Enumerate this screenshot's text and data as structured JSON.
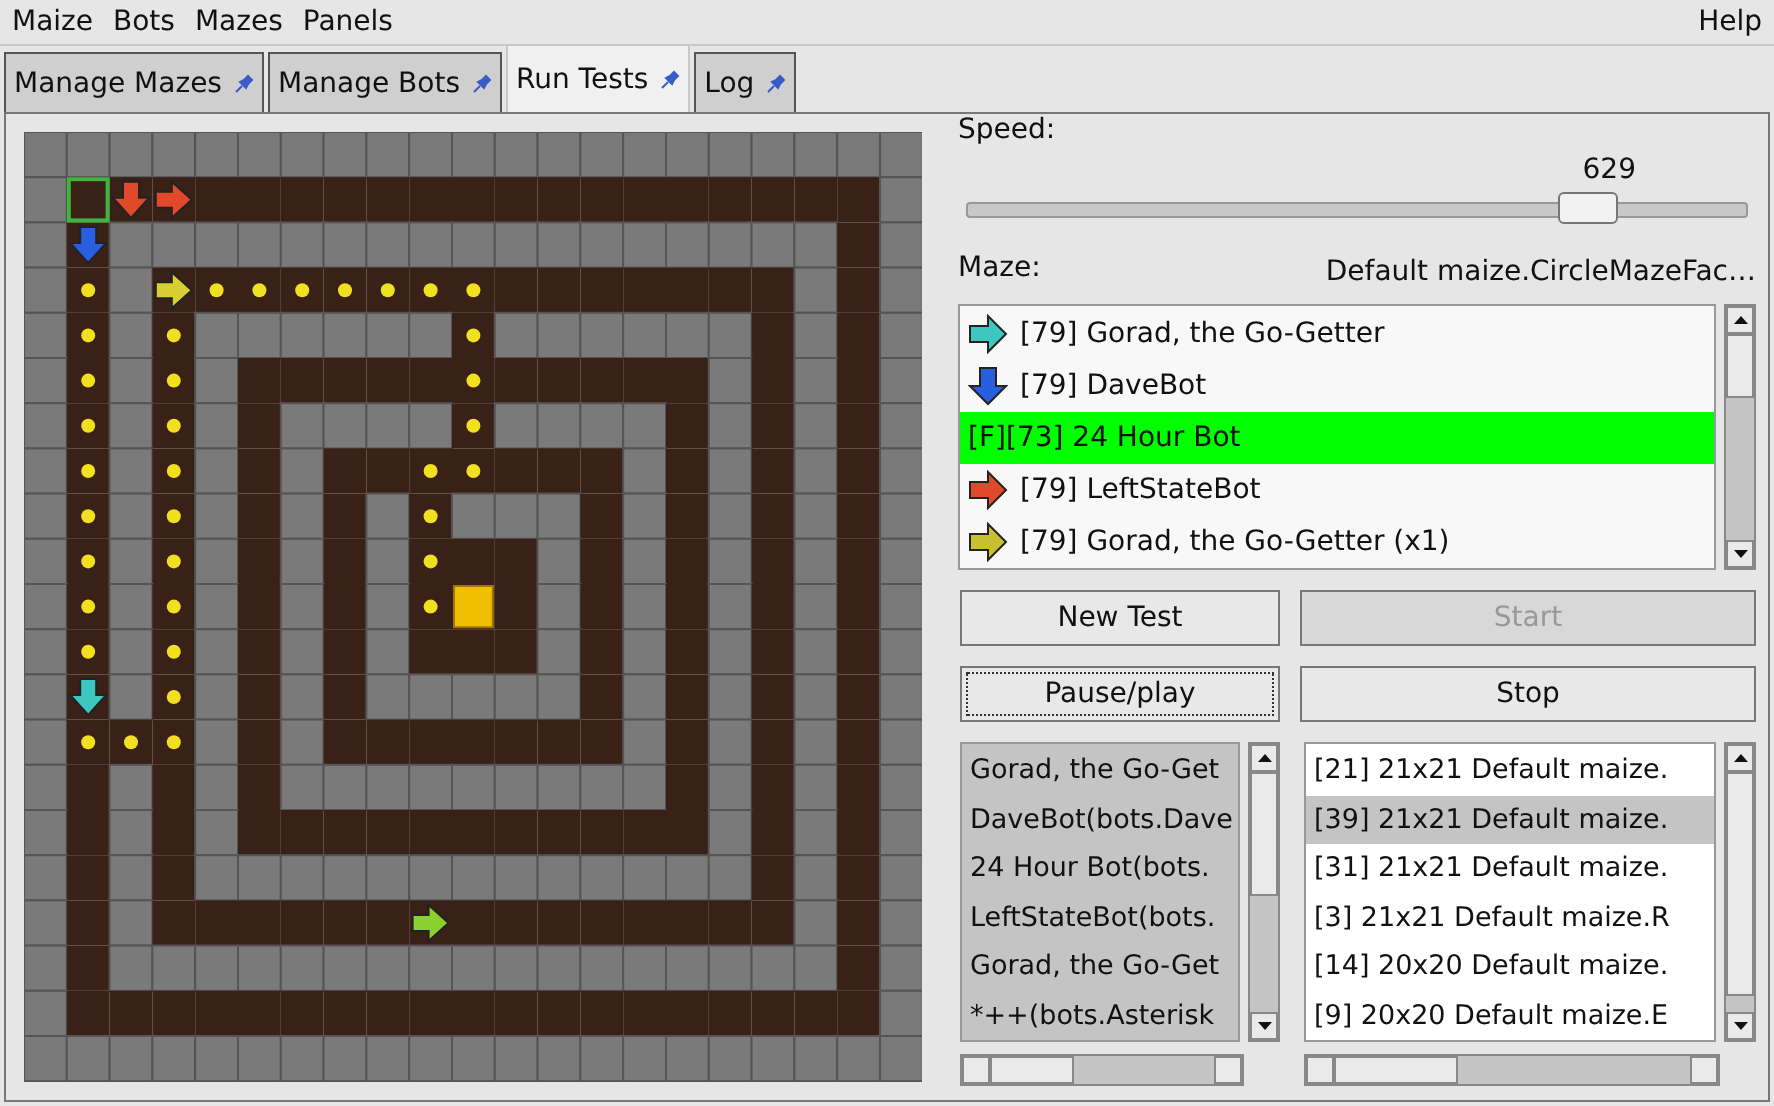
{
  "menu": [
    "Maize",
    "Bots",
    "Mazes",
    "Panels"
  ],
  "menu_help": "Help",
  "tabs": [
    {
      "label": "Manage Mazes",
      "selected": false
    },
    {
      "label": "Manage Bots",
      "selected": false
    },
    {
      "label": "Run Tests",
      "selected": true
    },
    {
      "label": "Log",
      "selected": false
    }
  ],
  "speed": {
    "label": "Speed:",
    "value": "629",
    "level": 0.815
  },
  "maze": {
    "label": "Maze:",
    "value": "Default maize.CircleMazeFac…"
  },
  "bots": [
    {
      "label": "[79] Gorad, the Go-Getter",
      "kind": "arrow-right",
      "color": "#3cc8c0",
      "selected": false
    },
    {
      "label": "[79] DaveBot",
      "kind": "arrow-down",
      "color": "#2a5ee0",
      "selected": false
    },
    {
      "label": "[F][73] 24 Hour Bot",
      "kind": "none",
      "selected": true
    },
    {
      "label": "[79] LeftStateBot",
      "kind": "arrow-right",
      "color": "#e04a2a",
      "selected": false
    },
    {
      "label": "[79] Gorad, the Go-Getter (x1)",
      "kind": "arrow-right",
      "color": "#c8c030",
      "selected": false
    }
  ],
  "buttons": [
    {
      "label": "New Test",
      "disabled": false,
      "focused": false
    },
    {
      "label": "Start",
      "disabled": true,
      "focused": false
    },
    {
      "label": "Pause/play",
      "disabled": false,
      "focused": true
    },
    {
      "label": "Stop",
      "disabled": false,
      "focused": false
    }
  ],
  "test_bots": [
    "Gorad, the Go-Get",
    "DaveBot(bots.Dave",
    "24 Hour Bot(bots.",
    "LeftStateBot(bots.",
    "Gorad, the Go-Get",
    "*++(bots.Asterisk"
  ],
  "test_mazes": [
    {
      "label": "[21] 21x21 Default maize.",
      "selected": false
    },
    {
      "label": "[39] 21x21 Default maize.",
      "selected": true
    },
    {
      "label": "[31] 21x21 Default maize.",
      "selected": false
    },
    {
      "label": "[3] 21x21 Default maize.R",
      "selected": false
    },
    {
      "label": "[14] 20x20 Default maize.",
      "selected": false
    },
    {
      "label": "[9] 20x20 Default maize.E",
      "selected": false
    }
  ]
}
